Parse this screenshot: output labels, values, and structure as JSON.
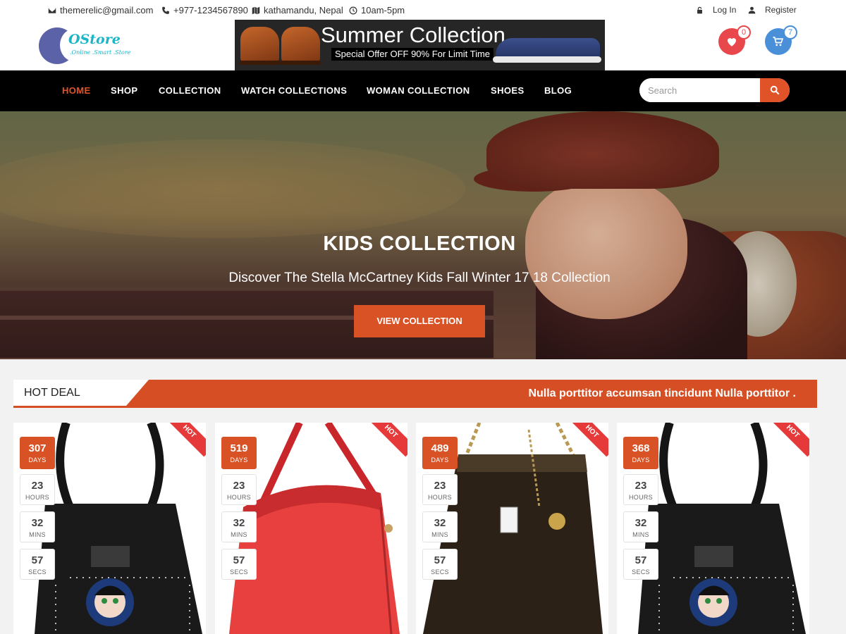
{
  "topbar": {
    "email": "themerelic@gmail.com",
    "phone": "+977-1234567890",
    "location": "kathamandu, Nepal",
    "hours": "10am-5pm",
    "login": "Log In",
    "register": "Register"
  },
  "logo": {
    "name": "OStore",
    "tagline": ".Online .Smart .Store"
  },
  "banner": {
    "title": "Summer Collection",
    "subtitle": "Special Offer OFF 90% For Limit Time"
  },
  "header": {
    "wishlist_count": "0",
    "cart_count": "7"
  },
  "nav": {
    "items": [
      "HOME",
      "SHOP",
      "COLLECTION",
      "WATCH COLLECTIONS",
      "WOMAN COLLECTION",
      "SHOES",
      "BLOG"
    ],
    "active": "HOME"
  },
  "search": {
    "placeholder": "Search",
    "value": ""
  },
  "hero": {
    "title": "KIDS COLLECTION",
    "subtitle": "Discover The Stella McCartney Kids Fall Winter 17 18 Collection",
    "button": "VIEW COLLECTION"
  },
  "deal": {
    "label": "HOT DEAL",
    "marquee": "Nulla porttitor accumsan tincidunt Nulla porttitor ."
  },
  "countdown_labels": {
    "days": "DAYS",
    "hours": "HOURS",
    "mins": "MINS",
    "secs": "SECS"
  },
  "products": [
    {
      "badge": "HOT",
      "days": "307",
      "hours": "23",
      "mins": "32",
      "secs": "57",
      "image": "black-studded-handbag"
    },
    {
      "badge": "HOT",
      "days": "519",
      "hours": "23",
      "mins": "32",
      "secs": "57",
      "image": "red-leather-handbag"
    },
    {
      "badge": "HOT",
      "days": "489",
      "hours": "23",
      "mins": "32",
      "secs": "57",
      "image": "black-patent-tote"
    },
    {
      "badge": "HOT",
      "days": "368",
      "hours": "23",
      "mins": "32",
      "secs": "57",
      "image": "black-studded-handbag"
    }
  ],
  "colors": {
    "accent": "#d95226",
    "nav_bg": "#000000",
    "wishlist": "#e8474c",
    "cart": "#4a90d9",
    "logo_blue": "#5b62a8",
    "logo_teal": "#1bb5c7"
  }
}
